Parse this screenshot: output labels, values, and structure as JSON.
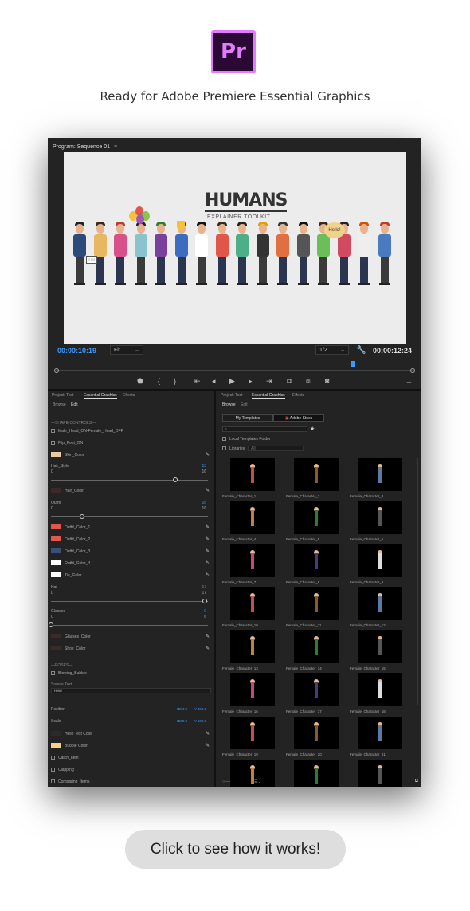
{
  "promo": {
    "logo_text": "Pr",
    "tagline": "Ready for Adobe Premiere Essential Graphics",
    "cta": "Click to see how it works!"
  },
  "program": {
    "title": "Program: Sequence 01",
    "menu_icon": "menu-icon",
    "timecode_current": "00:00:10:19",
    "timecode_total": "00:00:12:24",
    "fit": "Fit",
    "resolution": "1/2",
    "video_title": "HUMANS",
    "video_subtitle": "EXPLAINER TOOLKIT",
    "sign_text": "ITEM",
    "bubble_text": "Hello!"
  },
  "left_panel": {
    "tabs": [
      "Project: Test",
      "Essential Graphics",
      "Effects"
    ],
    "subtabs": [
      "Browse",
      "Edit"
    ],
    "shape_controls_heading": "—SHAPE CONTROLS—",
    "checkbox_head": "Male_Head_ON-Female_Head_OFF",
    "checkbox_flip": "Flip_Foot_ON",
    "skin_color": "Skin_Color",
    "hair_style": {
      "label": "Hair_Style",
      "value": "13",
      "min": "0",
      "max": "16",
      "position": 0.81
    },
    "hair_color": "Hair_Color",
    "outfit": {
      "label": "Outfit",
      "value": "16",
      "min": "0",
      "max": "16",
      "position": 0.2
    },
    "outfit_colors": [
      "Outfit_Color_1",
      "Outfit_Color_2",
      "Outfit_Color_3",
      "Outfit_Color_4"
    ],
    "tie_color": "Tie_Color",
    "hat": {
      "label": "Hat",
      "value": "17",
      "min": "0",
      "max": "17",
      "position": 1.0
    },
    "glasses": {
      "label": "Glasses",
      "value": "0",
      "min": "0",
      "max": "6",
      "position": 0.0
    },
    "glasses_color": "Glasses_Color",
    "shoe_color": "Shoe_Color",
    "poses_heading": "—POSES—",
    "blowing_bubble": "Blowing_Bubble",
    "source_text_label": "Source Text",
    "source_text_value": "Hello!",
    "position": {
      "label": "Position",
      "x_label": "X",
      "x": "984.0",
      "y_label": "Y",
      "y": "468.0"
    },
    "scale": {
      "label": "Scale",
      "x_label": "X",
      "x": "100.0",
      "y_label": "Y",
      "y": "100.0"
    },
    "hello_text_color": "Hello Text Color",
    "bubble_color": "Bubble Color",
    "catch_item": "Catch_Item",
    "clapping": "Clapping",
    "comparing_items": "Comparing_Items",
    "colors": {
      "skin": "#f0c8a0",
      "hair": "#3a2a2a",
      "outfit1": "#e0574a",
      "outfit2": "#e05a4a",
      "outfit3": "#3b4f7a",
      "outfit4": "#ffffff",
      "tie": "#ffffff",
      "hello_text": "#2a2a2a",
      "bubble": "#f2d28a"
    }
  },
  "right_panel": {
    "tabs": [
      "Project: Test",
      "Essential Graphics",
      "Effects"
    ],
    "subtabs": [
      "Browse",
      "Edit"
    ],
    "my_templates": "My Templates",
    "adobe_stock": "Adobe Stock",
    "local_folder": "Local Templates Folder",
    "libraries": "Libraries",
    "libraries_value": "All",
    "templates": [
      "Female_Character_1",
      "Female_Character_2",
      "Female_Character_3",
      "Female_Character_4",
      "Female_Character_5",
      "Female_Character_6",
      "Female_Character_7",
      "Female_Character_8",
      "Female_Character_9",
      "Female_Character_10",
      "Female_Character_11",
      "Female_Character_12",
      "Female_Character_13",
      "Female_Character_14",
      "Female_Character_15",
      "Female_Character_16",
      "Female_Character_17",
      "Female_Character_18",
      "Female_Character_19",
      "Female_Character_20",
      "Female_Character_21",
      "",
      "",
      ""
    ]
  },
  "accent": "#3a9bff"
}
